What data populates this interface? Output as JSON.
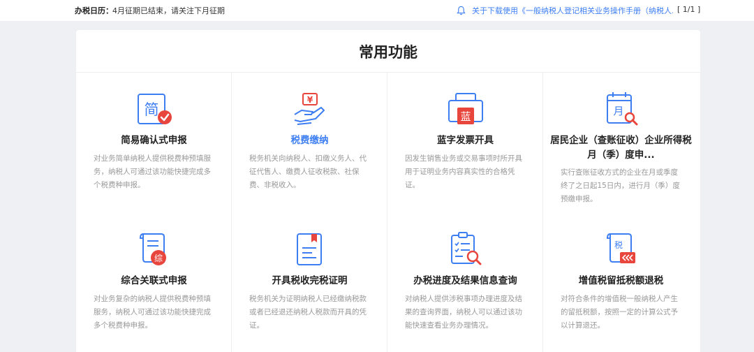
{
  "header": {
    "calendar_label": "办税日历：",
    "calendar_text": "4月征期已结束，请关注下月征期",
    "bell_icon": "bell-icon",
    "notice": "关于下载使用《一般纳税人登记相关业务操作手册（纳税人...",
    "pager": "[ 1/1 ]"
  },
  "panel": {
    "title": "常用功能",
    "cards": [
      {
        "icon": "simple-declaration-icon",
        "title": "简易确认式申报",
        "desc": "对业务简单纳税人提供税费种预填服务，纳税人可通过该功能快捷完成多个税费种申报。",
        "icon_glyph": "简"
      },
      {
        "icon": "tax-payment-icon",
        "title": "税费缴纳",
        "desc": "税务机关向纳税人、扣缴义务人、代征代售人、缴费人征收税款、社保费、非税收入。",
        "icon_glyph": "¥"
      },
      {
        "icon": "blue-invoice-icon",
        "title": "蓝字发票开具",
        "desc": "因发生销售业务或交易事项时所开具用于证明业务内容真实性的合格凭证。",
        "icon_glyph": "蓝"
      },
      {
        "icon": "resident-enterprise-icon",
        "title": "居民企业（查账征收）企业所得税月（季）度申...",
        "desc": "实行查账征收方式的企业在月或季度终了之日起15日内，进行月（季）度预缴申报。",
        "icon_glyph": "月"
      },
      {
        "icon": "comprehensive-declaration-icon",
        "title": "综合关联式申报",
        "desc": "对业务复杂的纳税人提供税费种预填服务，纳税人可通过该功能快捷完成多个税费种申报。",
        "icon_glyph": "综"
      },
      {
        "icon": "tax-certificate-icon",
        "title": "开具税收完税证明",
        "desc": "税务机关为证明纳税人已经缴纳税款或者已经退还纳税人税款而开具的凭证。",
        "icon_glyph": ""
      },
      {
        "icon": "progress-query-icon",
        "title": "办税进度及结果信息查询",
        "desc": "对纳税人提供涉税事项办理进度及结果的查询界面，纳税人可以通过该功能快速查看业务办理情况。",
        "icon_glyph": ""
      },
      {
        "icon": "vat-refund-icon",
        "title": "增值税留抵税额退税",
        "desc": "对符合条件的增值税一般纳税人产生的留抵税额，按照一定的计算公式予以计算退还。",
        "icon_glyph": "税"
      }
    ]
  },
  "colors": {
    "accent": "#3d7ef2",
    "red": "#e8453c",
    "title": "#222222",
    "desc": "#999999"
  }
}
